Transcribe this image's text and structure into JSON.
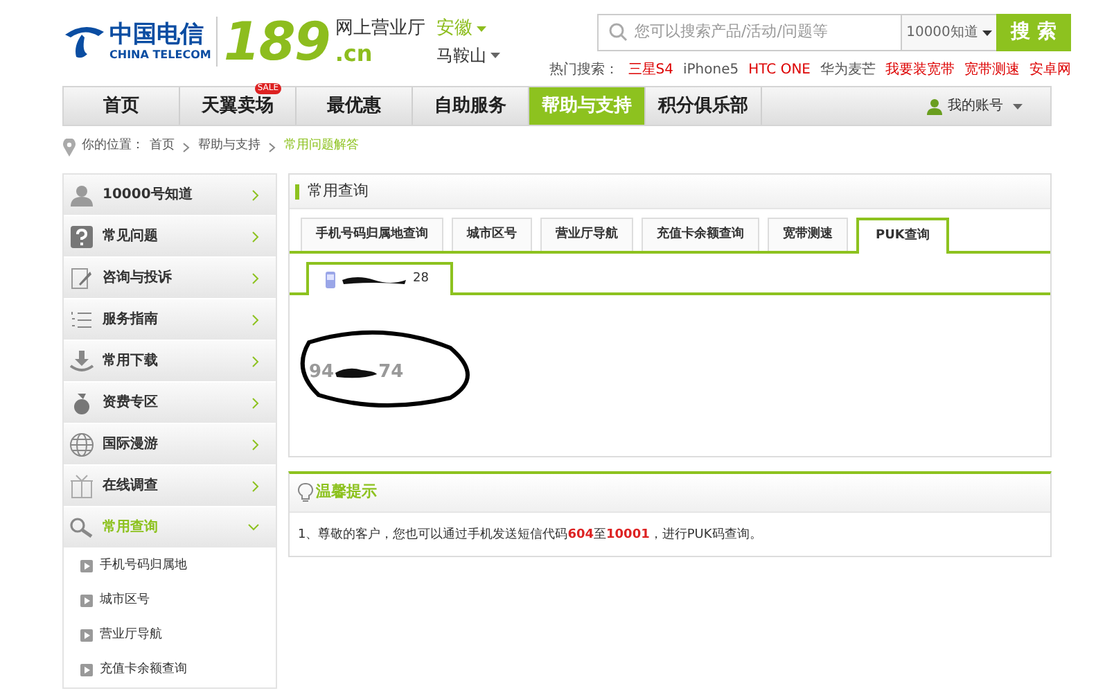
{
  "logo": {
    "brand_cn": "中国电信",
    "brand_en": "CHINA TELECOM",
    "number": "189",
    "domain": ".cn",
    "site_name": "网上营业厅"
  },
  "location": {
    "province": "安徽",
    "city": "马鞍山"
  },
  "search": {
    "placeholder": "您可以搜索产品/活动/问题等",
    "scope": "10000知道",
    "button": "搜 索"
  },
  "hot_search": {
    "label": "热门搜索：",
    "items": [
      {
        "text": "三星S4",
        "color": "#dd0000"
      },
      {
        "text": "iPhone5",
        "color": "#555555"
      },
      {
        "text": "HTC ONE",
        "color": "#dd0000"
      },
      {
        "text": "华为麦芒",
        "color": "#555555"
      },
      {
        "text": "我要装宽带",
        "color": "#dd0000"
      },
      {
        "text": "宽带测速",
        "color": "#dd0000"
      },
      {
        "text": "安卓网",
        "color": "#dd0000"
      }
    ]
  },
  "nav": {
    "items": [
      {
        "label": "首页",
        "selected": false
      },
      {
        "label": "天翼卖场",
        "selected": false,
        "badge": "SALE"
      },
      {
        "label": "最优惠",
        "selected": false
      },
      {
        "label": "自助服务",
        "selected": false
      },
      {
        "label": "帮助与支持",
        "selected": true
      },
      {
        "label": "积分俱乐部",
        "selected": false
      }
    ],
    "account": "我的账号"
  },
  "breadcrumb": {
    "prefix": "你的位置：",
    "items": [
      {
        "text": "首页",
        "selected": false
      },
      {
        "text": "帮助与支持",
        "selected": false
      },
      {
        "text": "常用问题解答",
        "selected": true
      }
    ]
  },
  "sidebar": {
    "items": [
      {
        "label": "10000号知道",
        "kind": "person",
        "expanded": false
      },
      {
        "label": "常见问题",
        "kind": "question",
        "expanded": false
      },
      {
        "label": "咨询与投诉",
        "kind": "note",
        "expanded": false
      },
      {
        "label": "服务指南",
        "kind": "list",
        "expanded": false
      },
      {
        "label": "常用下载",
        "kind": "download",
        "expanded": false
      },
      {
        "label": "资费专区",
        "kind": "bag",
        "expanded": false
      },
      {
        "label": "国际漫游",
        "kind": "globe",
        "expanded": false
      },
      {
        "label": "在线调查",
        "kind": "box",
        "expanded": false
      },
      {
        "label": "常用查询",
        "kind": "search",
        "expanded": true,
        "children": [
          {
            "label": "手机号码归属地"
          },
          {
            "label": "城市区号"
          },
          {
            "label": "营业厅导航"
          },
          {
            "label": "充值卡余额查询"
          }
        ]
      }
    ]
  },
  "panel": {
    "title": "常用查询",
    "tabs": [
      {
        "label": "手机号码归属地查询",
        "selected": false
      },
      {
        "label": "城市区号",
        "selected": false
      },
      {
        "label": "营业厅导航",
        "selected": false
      },
      {
        "label": "充值卡余额查询",
        "selected": false
      },
      {
        "label": "宽带测速",
        "selected": false
      },
      {
        "label": "PUK查询",
        "selected": true
      }
    ],
    "phone_tab": {
      "visible_text": "28"
    },
    "puk": {
      "start": "94",
      "end": "74"
    }
  },
  "tips": {
    "title": "温馨提示",
    "items": [
      "1、尊敬的客户，您也可以通过手机发送短信代码**604**至**10001**，进行PUK码查询。"
    ]
  }
}
